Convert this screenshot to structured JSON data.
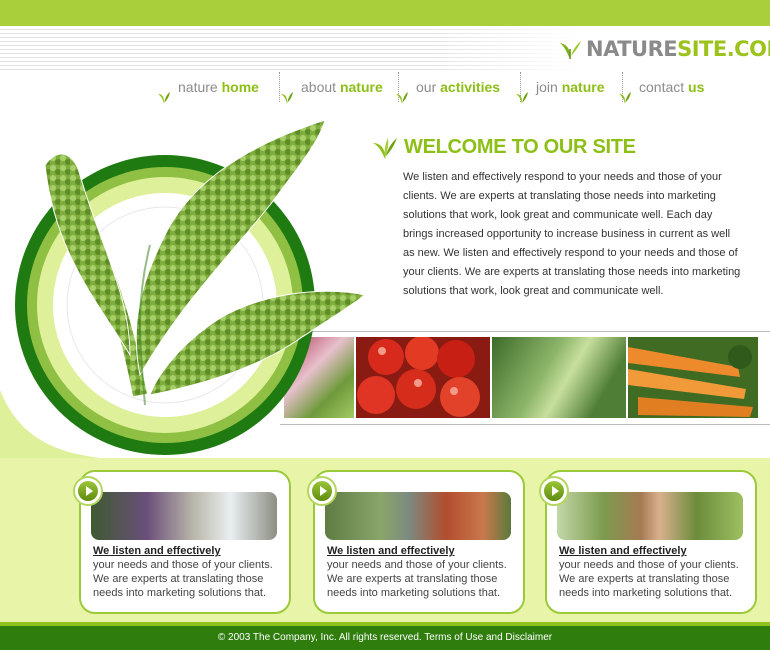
{
  "logo": {
    "part1": "NATURE",
    "part2": "SITE.COM"
  },
  "nav": {
    "items": [
      {
        "light": "nature",
        "bold": "home"
      },
      {
        "light": "about",
        "bold": "nature"
      },
      {
        "light": "our",
        "bold": "activities"
      },
      {
        "light": "join",
        "bold": "nature"
      },
      {
        "light": "contact",
        "bold": "us"
      }
    ]
  },
  "welcome": {
    "title": "WELCOME TO OUR SITE",
    "text": "We listen and effectively respond to your needs and those of your clients. We are experts at translating those needs into marketing solutions that work, look great and communicate well. Each day brings increased opportunity to increase business in current as well as new.  We listen and effectively respond to your needs and those of your clients. We are experts at translating those needs into marketing solutions that work, look great and communicate well."
  },
  "cards": [
    {
      "heading": "We listen and effectively",
      "text": "your needs and those of your clients. We are experts at translating those needs into marketing solutions that."
    },
    {
      "heading": "We listen and effectively",
      "text": "your needs and those of your clients. We are experts at translating those needs into marketing solutions that."
    },
    {
      "heading": "We listen and effectively",
      "text": "your needs and those of your clients. We are experts at translating those needs into marketing solutions that."
    }
  ],
  "footer": {
    "text": "© 2003 The Company, Inc. All rights reserved. Terms of Use and Disclaimer"
  },
  "colors": {
    "brand_green": "#8dbf17",
    "dark_green": "#2e7d0d",
    "light_green": "#e8f5a8"
  },
  "icons": {
    "nav": "leaf-icon",
    "welcome": "leaf-icon",
    "card": "play-icon"
  }
}
